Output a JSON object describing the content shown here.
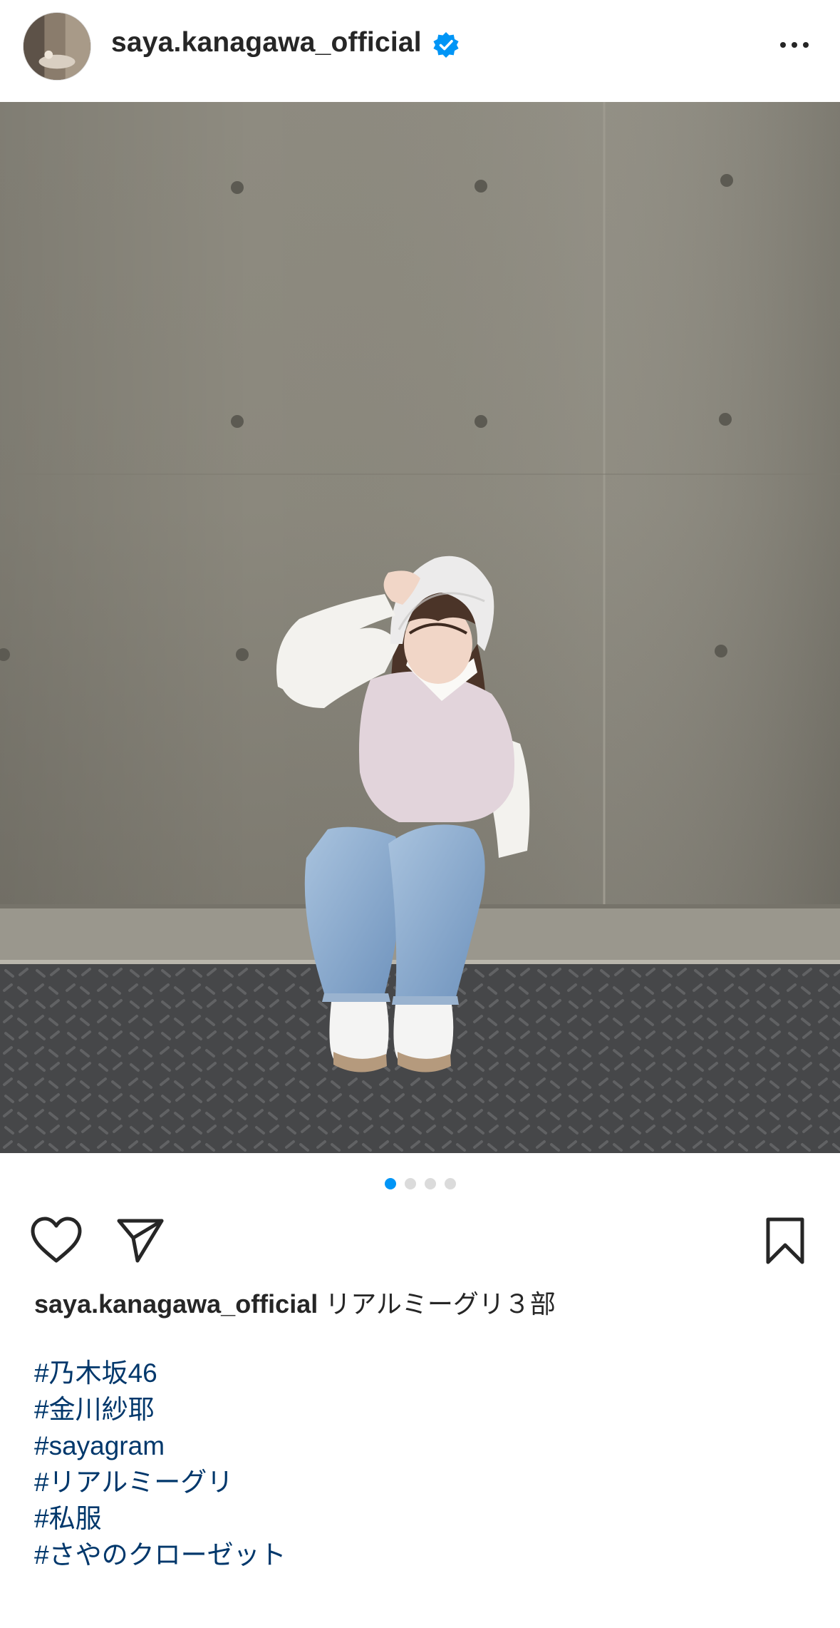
{
  "header": {
    "username": "saya.kanagawa_official",
    "verified": true,
    "avatar_icon": "profile-avatar",
    "more_icon": "more-horizontal-icon"
  },
  "post": {
    "image_description_icon": "photo",
    "carousel": {
      "count": 4,
      "active_index": 0
    },
    "actions": {
      "like_icon": "heart-icon",
      "share_icon": "send-icon",
      "save_icon": "bookmark-icon"
    },
    "caption": {
      "username": "saya.kanagawa_official",
      "text": "リアルミーグリ３部"
    },
    "hashtags": [
      "#乃木坂46",
      "#金川紗耶",
      "#sayagram",
      "#リアルミーグリ",
      "#私服",
      "#さやのクローゼット"
    ]
  },
  "colors": {
    "accent_blue": "#0095f6",
    "hashtag_blue": "#00376b",
    "text": "#262626",
    "dot_inactive": "#dbdbdb"
  }
}
